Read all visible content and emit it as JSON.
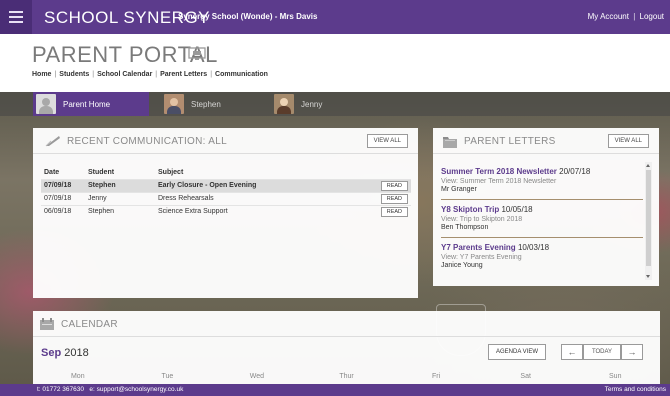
{
  "topbar": {
    "brand": "SCHOOL SYNERGY",
    "school": "Synergy School (Wonde) - Mrs Davis",
    "my_account": "My Account",
    "separator": "|",
    "logout": "Logout"
  },
  "header": {
    "title": "PARENT PORTAL",
    "nav": [
      "Home",
      "Students",
      "School Calendar",
      "Parent Letters",
      "Communication"
    ],
    "nav_separator": "|"
  },
  "student_tabs": [
    {
      "label": "Parent Home",
      "active": true
    },
    {
      "label": "Stephen",
      "active": false
    },
    {
      "label": "Jenny",
      "active": false
    }
  ],
  "recent_communication": {
    "title": "RECENT COMMUNICATION: ALL",
    "view_all": "VIEW ALL",
    "columns": [
      "Date",
      "Student",
      "Subject"
    ],
    "rows": [
      {
        "date": "07/09/18",
        "student": "Stephen",
        "subject": "Early Closure - Open Evening",
        "action": "READ"
      },
      {
        "date": "07/09/18",
        "student": "Jenny",
        "subject": "Dress Rehearsals",
        "action": "READ"
      },
      {
        "date": "06/09/18",
        "student": "Stephen",
        "subject": "Science Extra Support",
        "action": "READ"
      }
    ]
  },
  "parent_letters": {
    "title": "PARENT LETTERS",
    "view_all": "VIEW ALL",
    "items": [
      {
        "title": "Summer Term 2018 Newsletter",
        "date": "20/07/18",
        "view": "View: Summer Term 2018 Newsletter",
        "author": "Mr Granger"
      },
      {
        "title": "Y8 Skipton Trip",
        "date": "10/05/18",
        "view": "View: Trip to Skipton 2018",
        "author": "Ben Thompson"
      },
      {
        "title": "Y7 Parents Evening",
        "date": "10/03/18",
        "view": "View: Y7 Parents Evening",
        "author": "Janice Young"
      }
    ]
  },
  "calendar": {
    "title": "CALENDAR",
    "month": "Sep",
    "year": "2018",
    "agenda_view": "AGENDA VIEW",
    "prev": "←",
    "today": "TODAY",
    "next": "→",
    "days": [
      "Mon",
      "Tue",
      "Wed",
      "Thur",
      "Fri",
      "Sat",
      "Sun"
    ]
  },
  "footer": {
    "phone": "t: 01772 367630",
    "email": "e: support@schoolsynergy.co.uk",
    "terms": "Terms and conditions"
  },
  "colors": {
    "brand_purple": "#5c3b8c",
    "panel_white": "#ffffff",
    "muted_text": "#8a8a8a"
  }
}
